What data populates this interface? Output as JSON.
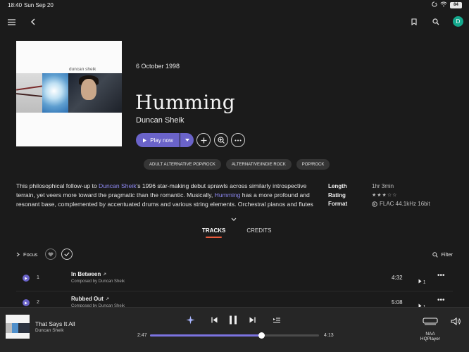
{
  "status": {
    "time": "18:40",
    "date": "Sun Sep 20",
    "battery": "84"
  },
  "nav": {
    "avatar_letter": "D"
  },
  "album": {
    "cover_text": "duncan sheik",
    "release_date": "6 October 1998",
    "title": "Humming",
    "artist": "Duncan Sheik",
    "play_label": "Play now",
    "genres": [
      "ADULT ALTERNATIVE POP/ROCK",
      "ALTERNATIVE/INDIE ROCK",
      "POP/ROCK"
    ]
  },
  "description": {
    "p1": "This philosophical follow-up to ",
    "link1": "Duncan Sheik",
    "p2": "'s 1996 star-making debut sprawls across similarly introspective terrain, yet veers more toward the pragmatic than the romantic. Musically, ",
    "link2": "Humming",
    "p3": " has a more profound and resonant base, complemented by accentuated drums and various string elements. Orchestral pianos and flutes"
  },
  "meta": {
    "length_label": "Length",
    "length_value": "1hr 3min",
    "rating_label": "Rating",
    "rating_stars": "★★★☆☆",
    "rating_value": 3,
    "format_label": "Format",
    "format_value": "FLAC 44.1kHz 16bit"
  },
  "tabs": [
    {
      "label": "TRACKS"
    },
    {
      "label": "CREDITS"
    }
  ],
  "toolbar": {
    "focus_label": "Focus",
    "filter_label": "Filter"
  },
  "tracks": [
    {
      "num": "1",
      "title": "In Between",
      "composer": "Composed by Duncan Sheik",
      "duration": "4:32",
      "queue": "1"
    },
    {
      "num": "2",
      "title": "Rubbed Out",
      "composer": "Composed by Duncan Sheik",
      "duration": "5:08",
      "queue": "1"
    }
  ],
  "player": {
    "title": "That Says It All",
    "artist": "Duncan Sheik",
    "elapsed": "2:47",
    "total": "4:13",
    "progress": 0.66,
    "device_line1": "NAA",
    "device_line2": "HQPlayer"
  },
  "colors": {
    "accent": "#6a63c9",
    "link": "#8c87f0",
    "tab_underline": "#e95a3c",
    "background": "#1b1b1b"
  }
}
